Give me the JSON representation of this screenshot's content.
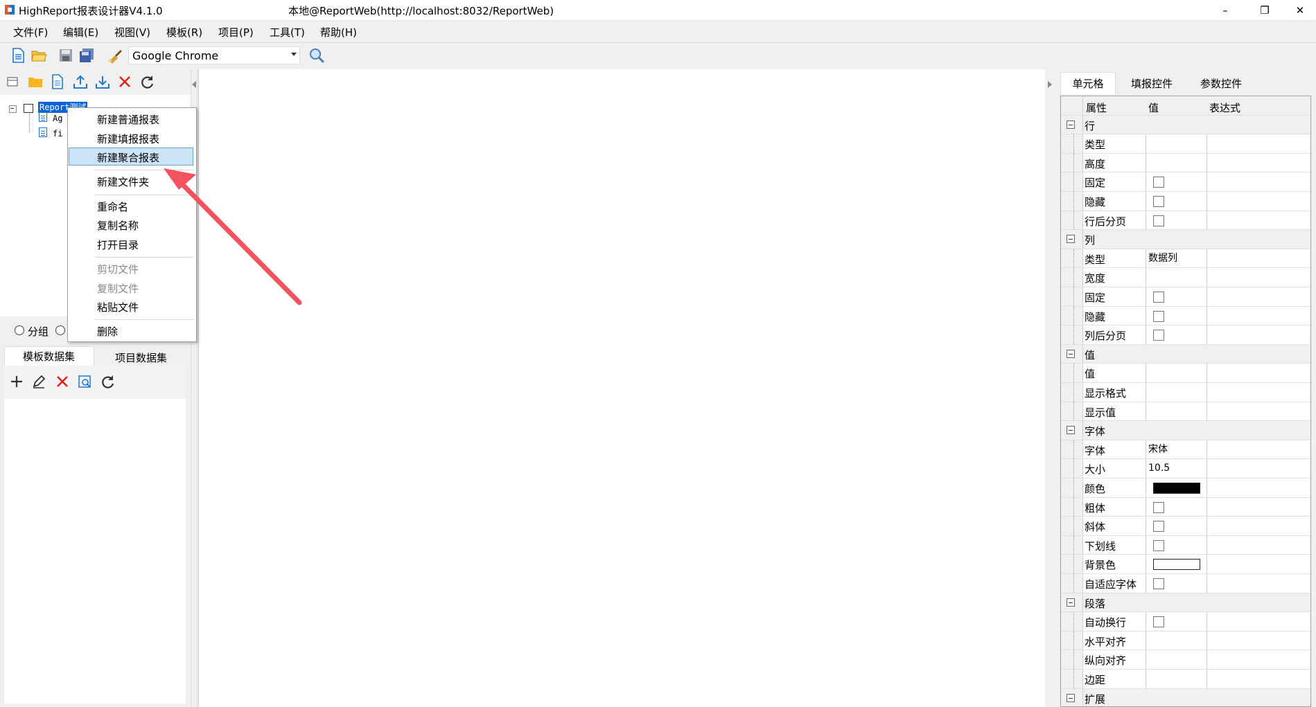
{
  "window": {
    "app_title": "HighReport报表设计器V4.1.0",
    "connection_title": "本地@ReportWeb(http://localhost:8032/ReportWeb)",
    "minimize": "–",
    "maximize": "❐",
    "close": "✕"
  },
  "menu": [
    "文件(F)",
    "编辑(E)",
    "视图(V)",
    "模板(R)",
    "项目(P)",
    "工具(T)",
    "帮助(H)"
  ],
  "toolbar": {
    "browser_value": "Google Chrome"
  },
  "tree": {
    "root_label": "Report测试",
    "children": [
      "Ag",
      "fi"
    ]
  },
  "context_menu": {
    "items": [
      "新建普通报表",
      "新建填报报表",
      "新建聚合报表",
      "新建文件夹",
      "重命名",
      "复制名称",
      "打开目录",
      "剪切文件",
      "复制文件",
      "粘贴文件",
      "删除"
    ],
    "highlighted": "新建聚合报表"
  },
  "left_bottom": {
    "radio_group_label": "分组",
    "tabs": [
      "模板数据集",
      "项目数据集"
    ]
  },
  "right_panel": {
    "tabs": [
      "单元格",
      "填报控件",
      "参数控件"
    ],
    "columns": [
      "属性",
      "值",
      "表达式"
    ],
    "rows": [
      {
        "cat": true,
        "name": "行"
      },
      {
        "name": "类型",
        "value": ""
      },
      {
        "name": "高度",
        "value": ""
      },
      {
        "name": "固定",
        "check": true
      },
      {
        "name": "隐藏",
        "check": true
      },
      {
        "name": "行后分页",
        "check": true
      },
      {
        "cat": true,
        "name": "列"
      },
      {
        "name": "类型",
        "value": "数据列"
      },
      {
        "name": "宽度",
        "value": ""
      },
      {
        "name": "固定",
        "check": true
      },
      {
        "name": "隐藏",
        "check": true
      },
      {
        "name": "列后分页",
        "check": true
      },
      {
        "cat": true,
        "name": "值"
      },
      {
        "name": "值",
        "value": ""
      },
      {
        "name": "显示格式",
        "value": ""
      },
      {
        "name": "显示值",
        "value": ""
      },
      {
        "cat": true,
        "name": "字体"
      },
      {
        "name": "字体",
        "value": "宋体"
      },
      {
        "name": "大小",
        "value": "10.5"
      },
      {
        "name": "颜色",
        "color": "#000000"
      },
      {
        "name": "粗体",
        "check": true
      },
      {
        "name": "斜体",
        "check": true
      },
      {
        "name": "下划线",
        "check": true
      },
      {
        "name": "背景色",
        "color": "#ffffff"
      },
      {
        "name": "自适应字体",
        "check": true
      },
      {
        "cat": true,
        "name": "段落"
      },
      {
        "name": "自动换行",
        "check": true
      },
      {
        "name": "水平对齐",
        "value": ""
      },
      {
        "name": "纵向对齐",
        "value": ""
      },
      {
        "name": "边距",
        "value": ""
      },
      {
        "cat": true,
        "name": "扩展"
      }
    ]
  },
  "colors": {
    "selection": "#0a64d8",
    "menu_highlight": "#cce4f7",
    "arrow": "#f2535f"
  }
}
